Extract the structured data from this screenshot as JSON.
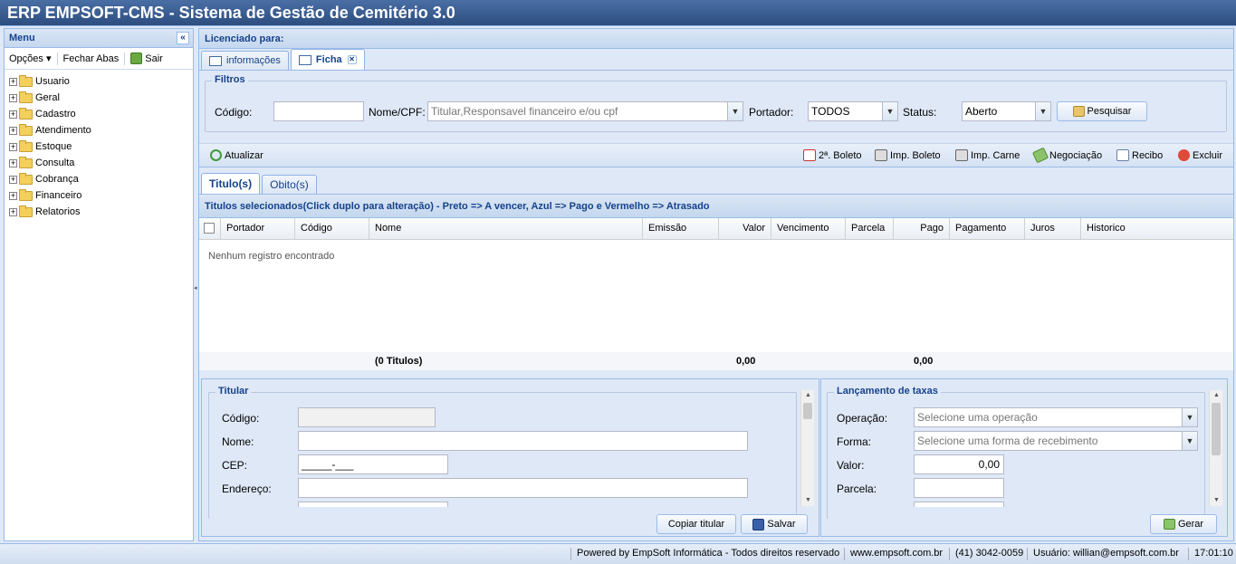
{
  "app": {
    "title": "ERP EMPSOFT-CMS - Sistema de Gestão de Cemitério 3.0"
  },
  "menu": {
    "title": "Menu",
    "toolbar": {
      "options": "Opções",
      "close_tabs": "Fechar Abas",
      "exit": "Sair"
    },
    "items": [
      "Usuario",
      "Geral",
      "Cadastro",
      "Atendimento",
      "Estoque",
      "Consulta",
      "Cobrança",
      "Financeiro",
      "Relatorios"
    ]
  },
  "main": {
    "licensed": "Licenciado para:",
    "tabs": [
      {
        "label": "informações"
      },
      {
        "label": "Ficha"
      }
    ],
    "filters": {
      "legend": "Filtros",
      "code_label": "Código:",
      "name_label": "Nome/CPF:",
      "name_placeholder": "Titular,Responsavel financeiro e/ou cpf",
      "portador_label": "Portador:",
      "portador_value": "TODOS",
      "status_label": "Status:",
      "status_value": "Aberto",
      "search_button": "Pesquisar"
    },
    "toolbar": {
      "refresh": "Atualizar",
      "boleto2": "2ª. Boleto",
      "print_boleto": "Imp. Boleto",
      "print_carne": "Imp. Carne",
      "negociacao": "Negociação",
      "recibo": "Recibo",
      "excluir": "Excluir"
    },
    "subtabs": [
      {
        "label": "Titulo(s)"
      },
      {
        "label": "Obito(s)"
      }
    ],
    "grid": {
      "title": "Titulos selecionados(Click duplo para alteração) - Preto => A vencer, Azul => Pago e Vermelho => Atrasado",
      "columns": [
        "Portador",
        "Código",
        "Nome",
        "Emissão",
        "Valor",
        "Vencimento",
        "Parcela",
        "Pago",
        "Pagamento",
        "Juros",
        "Historico"
      ],
      "empty": "Nenhum registro encontrado",
      "footer": {
        "count": "(0 Titulos)",
        "valor": "0,00",
        "pago": "0,00"
      }
    },
    "titular": {
      "legend": "Titular",
      "code_label": "Código:",
      "name_label": "Nome:",
      "cep_label": "CEP:",
      "cep_value": "_____-___",
      "address_label": "Endereço:",
      "copy_button": "Copiar titular",
      "save_button": "Salvar"
    },
    "taxas": {
      "legend": "Lançamento de taxas",
      "operation_label": "Operação:",
      "operation_placeholder": "Selecione uma operação",
      "form_label": "Forma:",
      "form_placeholder": "Selecione uma forma de recebimento",
      "value_label": "Valor:",
      "value": "0,00",
      "parcel_label": "Parcela:",
      "generate_button": "Gerar"
    }
  },
  "status": {
    "powered": "Powered by EmpSoft Informática - Todos direitos reservado",
    "site": "www.empsoft.com.br",
    "phone": "(41) 3042-0059",
    "user": "Usuário:  willian@empsoft.com.br",
    "time": "17:01:10"
  },
  "colors": {
    "header": "#2d4d7f",
    "panel_title": "#15428b",
    "border": "#99bbe8",
    "background": "#dfe8f6"
  }
}
